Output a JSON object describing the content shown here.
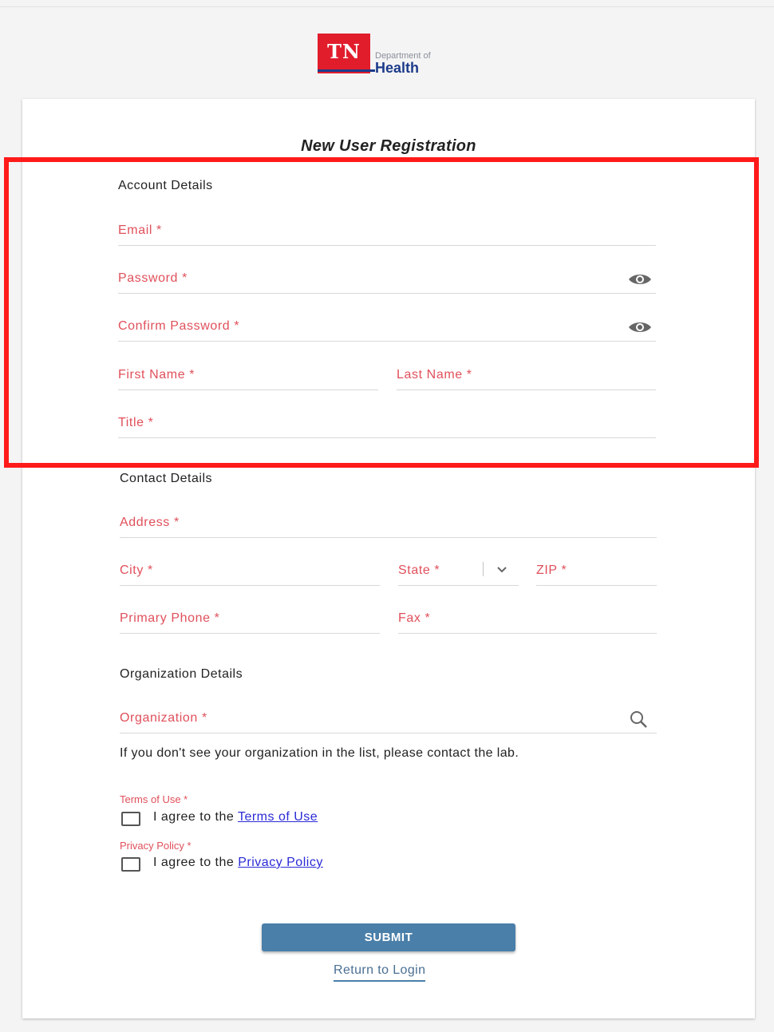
{
  "logo": {
    "abbr": "TN",
    "dept": "Department of",
    "name": "Health"
  },
  "title": "New User Registration",
  "account_section": {
    "heading": "Account Details",
    "email_label": "Email *",
    "password_label": "Password *",
    "confirm_password_label": "Confirm Password *",
    "first_name_label": "First Name *",
    "last_name_label": "Last Name *",
    "title_label": "Title *"
  },
  "contact_section": {
    "heading": "Contact Details",
    "address_label": "Address *",
    "city_label": "City *",
    "state_label": "State *",
    "zip_label": "ZIP *",
    "primary_phone_label": "Primary Phone *",
    "fax_label": "Fax *"
  },
  "org_section": {
    "heading": "Organization Details",
    "organization_label": "Organization *",
    "help_text": "If you don't see your organization in the list, please contact the lab."
  },
  "terms": {
    "label": "Terms of Use *",
    "prefix": "I agree to the ",
    "link": "Terms of Use"
  },
  "privacy": {
    "label": "Privacy Policy *",
    "prefix": "I agree to the ",
    "link": "Privacy Policy"
  },
  "actions": {
    "submit_label": "SUBMIT",
    "return_label": "Return to Login"
  },
  "colors": {
    "accent_red_label": "#e0505b",
    "submit_blue": "#4a7fa9",
    "highlight_red": "#ff1a1a",
    "link_blue": "#2a2ad6"
  },
  "icons": {
    "password_toggle": "eye-icon",
    "confirm_toggle": "eye-icon",
    "org_search": "search-icon",
    "state_dropdown": "chevron-down-icon"
  }
}
